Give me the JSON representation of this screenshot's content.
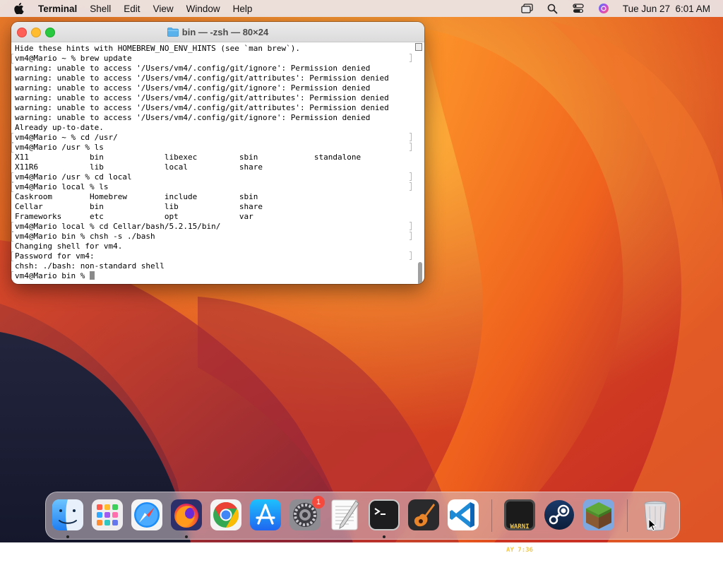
{
  "menubar": {
    "app_name": "Terminal",
    "items": [
      "Shell",
      "Edit",
      "View",
      "Window",
      "Help"
    ],
    "clock": "Tue Jun 27  6:01 AM"
  },
  "terminal": {
    "title": "bin — -zsh — 80×24",
    "lines": [
      {
        "text": "Hide these hints with HOMEBREW_NO_ENV_HINTS (see `man brew`).",
        "prompt": false
      },
      {
        "text": "vm4@Mario ~ % brew update",
        "prompt": true
      },
      {
        "text": "warning: unable to access '/Users/vm4/.config/git/ignore': Permission denied",
        "prompt": false
      },
      {
        "text": "warning: unable to access '/Users/vm4/.config/git/attributes': Permission denied",
        "prompt": false
      },
      {
        "text": "warning: unable to access '/Users/vm4/.config/git/ignore': Permission denied",
        "prompt": false
      },
      {
        "text": "warning: unable to access '/Users/vm4/.config/git/attributes': Permission denied",
        "prompt": false
      },
      {
        "text": "warning: unable to access '/Users/vm4/.config/git/attributes': Permission denied",
        "prompt": false
      },
      {
        "text": "warning: unable to access '/Users/vm4/.config/git/ignore': Permission denied",
        "prompt": false
      },
      {
        "text": "Already up-to-date.",
        "prompt": false
      },
      {
        "text": "vm4@Mario ~ % cd /usr/",
        "prompt": true
      },
      {
        "text": "vm4@Mario /usr % ls",
        "prompt": true
      },
      {
        "text": "X11             bin             libexec         sbin            standalone",
        "prompt": false
      },
      {
        "text": "X11R6           lib             local           share",
        "prompt": false
      },
      {
        "text": "vm4@Mario /usr % cd local",
        "prompt": true
      },
      {
        "text": "vm4@Mario local % ls",
        "prompt": true
      },
      {
        "text": "Caskroom        Homebrew        include         sbin",
        "prompt": false
      },
      {
        "text": "Cellar          bin             lib             share",
        "prompt": false
      },
      {
        "text": "Frameworks      etc             opt             var",
        "prompt": false
      },
      {
        "text": "vm4@Mario local % cd Cellar/bash/5.2.15/bin/",
        "prompt": true
      },
      {
        "text": "vm4@Mario bin % chsh -s ./bash",
        "prompt": true
      },
      {
        "text": "Changing shell for vm4.",
        "prompt": false
      },
      {
        "text": "Password for vm4:",
        "prompt": true
      },
      {
        "text": "chsh: ./bash: non-standard shell",
        "prompt": false
      }
    ],
    "current_prompt": "vm4@Mario bin % "
  },
  "dock": {
    "items": [
      {
        "name": "Finder",
        "icon": "finder-icon",
        "running": true
      },
      {
        "name": "Launchpad",
        "icon": "launchpad-icon",
        "running": false
      },
      {
        "name": "Safari",
        "icon": "safari-icon",
        "running": false
      },
      {
        "name": "Firefox",
        "icon": "firefox-icon",
        "running": true
      },
      {
        "name": "Google Chrome",
        "icon": "chrome-icon",
        "running": false
      },
      {
        "name": "App Store",
        "icon": "app-store-icon",
        "running": false
      },
      {
        "name": "System Settings",
        "icon": "system-settings-icon",
        "running": false,
        "badge": "1"
      },
      {
        "name": "TextEdit",
        "icon": "textedit-icon",
        "running": false
      },
      {
        "name": "Terminal",
        "icon": "terminal-icon",
        "running": true
      },
      {
        "name": "GarageBand",
        "icon": "garageband-icon",
        "running": false
      },
      {
        "name": "Visual Studio Code",
        "icon": "vscode-icon",
        "running": false
      },
      {
        "name": "Console",
        "icon": "console-icon",
        "running": false,
        "label_line1": "WARNI",
        "label_line2": "AY 7:36"
      },
      {
        "name": "Steam",
        "icon": "steam-icon",
        "running": false
      },
      {
        "name": "Minecraft",
        "icon": "minecraft-icon",
        "running": false
      },
      {
        "name": "Trash",
        "icon": "trash-icon",
        "running": false
      }
    ]
  },
  "colors": {
    "close": "#fe5f57",
    "minimize": "#febc2e",
    "maximize": "#28c840",
    "badge": "#f5493d"
  }
}
